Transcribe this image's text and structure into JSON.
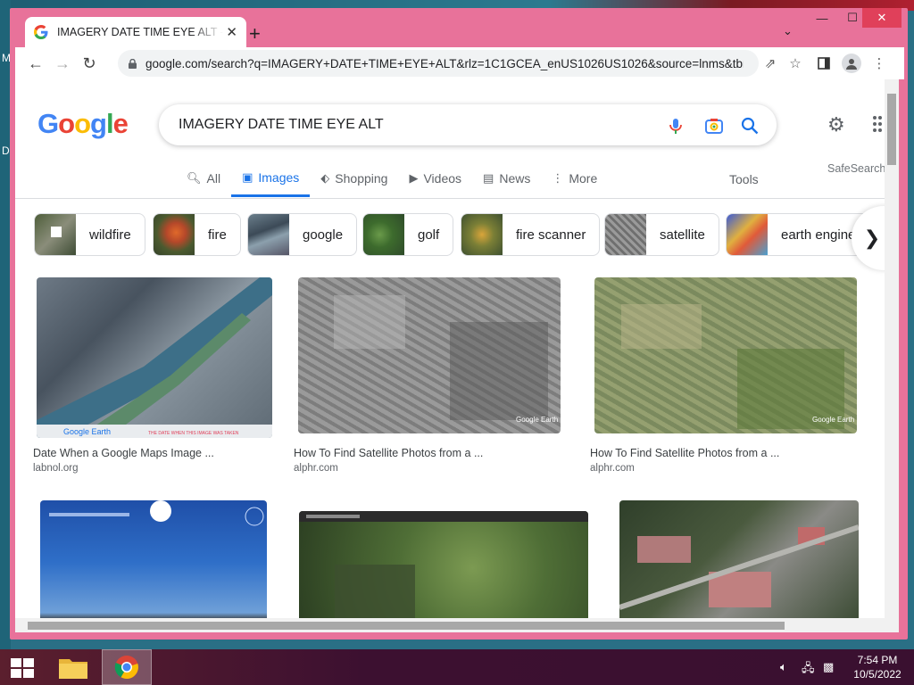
{
  "desktop": {
    "left_letters": [
      "M",
      "D"
    ]
  },
  "browser": {
    "tab": {
      "title": "IMAGERY DATE TIME EYE ALT - Google Search"
    },
    "url": "google.com/search?q=IMAGERY+DATE+TIME+EYE+ALT&rlz=1C1GCEA_enUS1026US1026&source=lnms&tbm=isch"
  },
  "google": {
    "logo": "Google",
    "query": "IMAGERY DATE TIME EYE ALT",
    "tabs": [
      {
        "label": "All",
        "icon": "search-icon"
      },
      {
        "label": "Images",
        "icon": "image-icon",
        "active": true
      },
      {
        "label": "Shopping",
        "icon": "tag-icon"
      },
      {
        "label": "Videos",
        "icon": "play-icon"
      },
      {
        "label": "News",
        "icon": "newspaper-icon"
      },
      {
        "label": "More",
        "icon": "more-vert-icon"
      }
    ],
    "tools": "Tools",
    "safesearch": "SafeSearch",
    "chips": [
      "wildfire",
      "fire",
      "google",
      "golf",
      "fire scanner",
      "satellite",
      "earth engine"
    ],
    "results": [
      {
        "title": "Date When a Google Maps Image ...",
        "source": "labnol.org",
        "watermark": "Google Earth",
        "caption": "THE DATE WHEN THIS IMAGE WAS TAKEN"
      },
      {
        "title": "How To Find Satellite Photos from a ...",
        "source": "alphr.com",
        "watermark": "Google Earth"
      },
      {
        "title": "How To Find Satellite Photos from a ...",
        "source": "alphr.com",
        "watermark": "Google Earth"
      },
      {
        "title": "",
        "source": ""
      },
      {
        "title": "",
        "source": ""
      },
      {
        "title": "",
        "source": ""
      }
    ]
  },
  "taskbar": {
    "time": "7:54 PM",
    "date": "10/5/2022"
  },
  "colors": {
    "window_frame": "#e8729a",
    "link_blue": "#1a73e8"
  }
}
